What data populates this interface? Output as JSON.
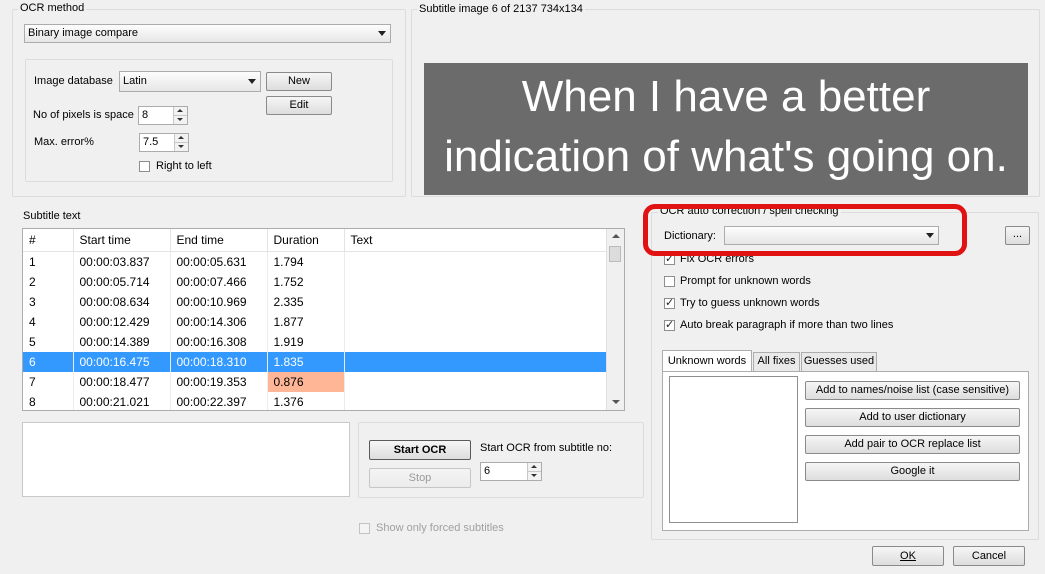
{
  "ocr_method": {
    "title": "OCR method",
    "method_value": "Binary image compare",
    "image_db_label": "Image database",
    "image_db_value": "Latin",
    "new_button": "New",
    "edit_button": "Edit",
    "pixels_space_label": "No of pixels is space",
    "pixels_space_value": "8",
    "max_error_label": "Max. error%",
    "max_error_value": "7.5",
    "right_to_left_label": "Right to left",
    "right_to_left_checked": false
  },
  "subtitle_image": {
    "title": "Subtitle image 6 of 2137   734x134",
    "text_line1": "When I have a better",
    "text_line2": "indication of what's going on."
  },
  "subtitle_text": {
    "title": "Subtitle text",
    "columns": [
      "#",
      "Start time",
      "End time",
      "Duration",
      "Text"
    ],
    "rows": [
      {
        "num": "1",
        "start": "00:00:03.837",
        "end": "00:00:05.631",
        "duration": "1.794",
        "text": ""
      },
      {
        "num": "2",
        "start": "00:00:05.714",
        "end": "00:00:07.466",
        "duration": "1.752",
        "text": ""
      },
      {
        "num": "3",
        "start": "00:00:08.634",
        "end": "00:00:10.969",
        "duration": "2.335",
        "text": ""
      },
      {
        "num": "4",
        "start": "00:00:12.429",
        "end": "00:00:14.306",
        "duration": "1.877",
        "text": ""
      },
      {
        "num": "5",
        "start": "00:00:14.389",
        "end": "00:00:16.308",
        "duration": "1.919",
        "text": ""
      },
      {
        "num": "6",
        "start": "00:00:16.475",
        "end": "00:00:18.310",
        "duration": "1.835",
        "text": ""
      },
      {
        "num": "7",
        "start": "00:00:18.477",
        "end": "00:00:19.353",
        "duration": "0.876",
        "text": ""
      },
      {
        "num": "8",
        "start": "00:00:21.021",
        "end": "00:00:22.397",
        "duration": "1.376",
        "text": ""
      }
    ],
    "selected_row": 5,
    "warning_row": 6
  },
  "ocr_controls": {
    "start_button": "Start OCR",
    "stop_button": "Stop",
    "start_from_label": "Start OCR from subtitle no:",
    "start_from_value": "6",
    "forced_label": "Show only forced subtitles"
  },
  "auto_correction": {
    "title": "OCR auto correction / spell checking",
    "dictionary_label": "Dictionary:",
    "dictionary_value": "",
    "browse_button": "...",
    "options": [
      {
        "label": "Fix OCR errors",
        "checked": true
      },
      {
        "label": "Prompt for unknown words",
        "checked": false
      },
      {
        "label": "Try to guess unknown words",
        "checked": true
      },
      {
        "label": "Auto break paragraph if more than two lines",
        "checked": true
      }
    ],
    "tabs": [
      "Unknown words",
      "All fixes",
      "Guesses used"
    ],
    "active_tab": 0,
    "actions": [
      "Add to names/noise list (case sensitive)",
      "Add to user dictionary",
      "Add pair to OCR replace list",
      "Google it"
    ]
  },
  "dialog": {
    "ok_button": "OK",
    "cancel_button": "Cancel"
  },
  "colors": {
    "selection": "#3399ff",
    "duration_warning": "#ffb696",
    "highlight_ring": "#e01212"
  }
}
